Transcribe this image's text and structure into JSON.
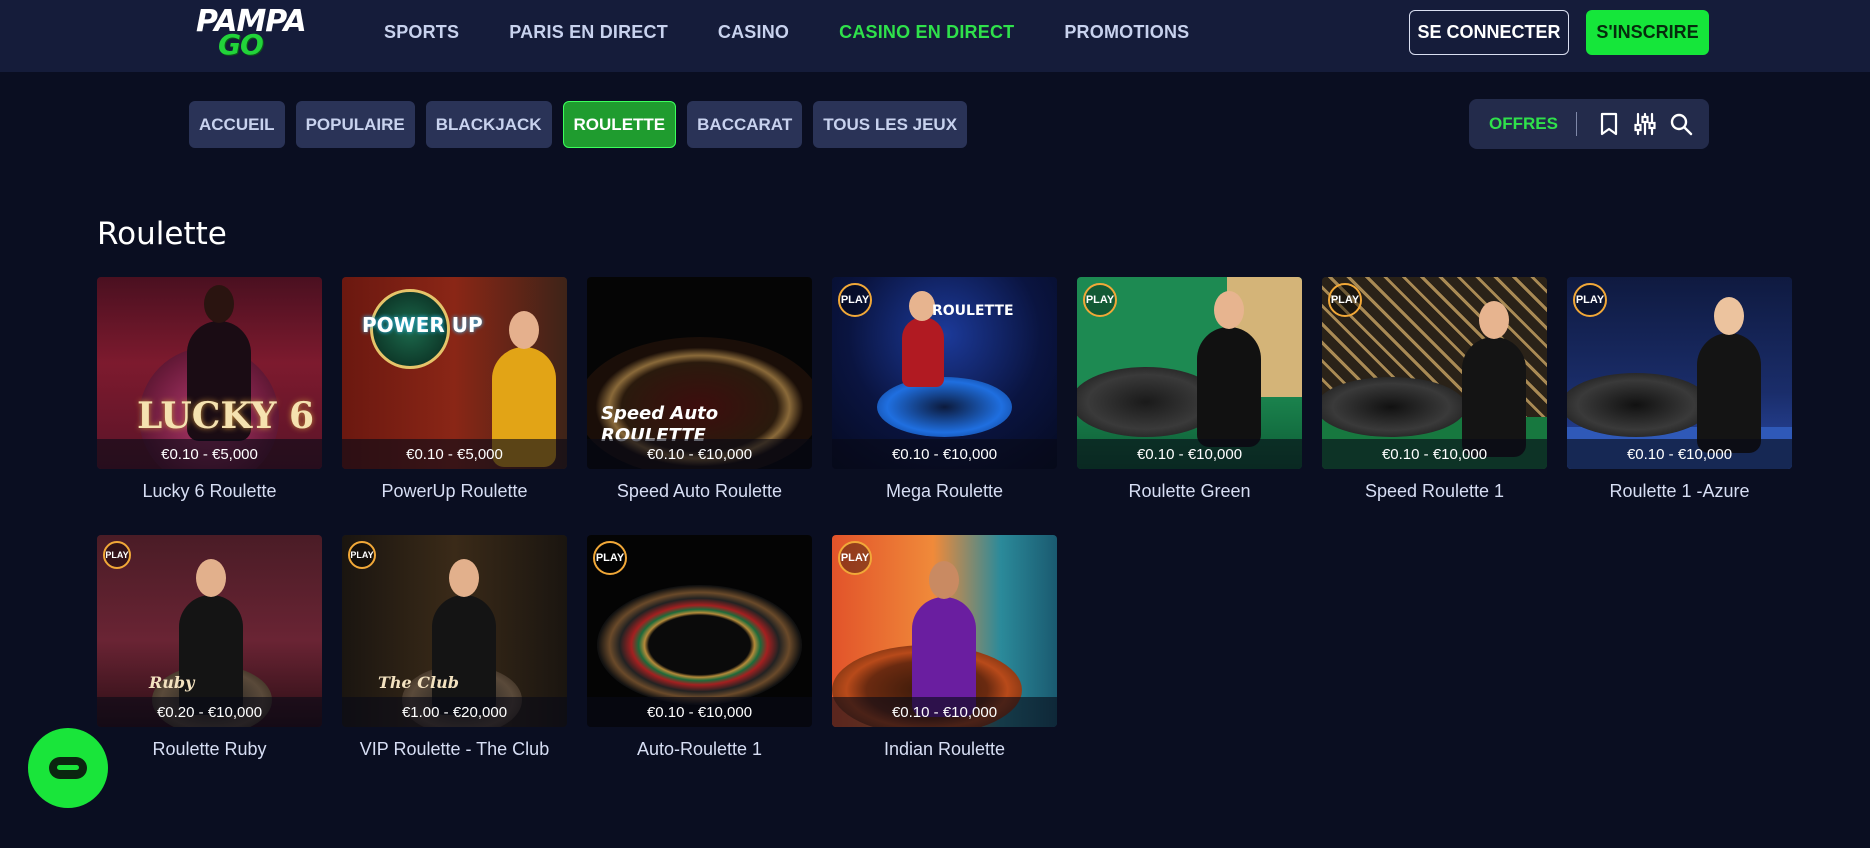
{
  "brand": {
    "line1": "PAMPA",
    "line2": "GO"
  },
  "nav": {
    "items": [
      {
        "label": "SPORTS",
        "active": false
      },
      {
        "label": "PARIS EN DIRECT",
        "active": false
      },
      {
        "label": "CASINO",
        "active": false
      },
      {
        "label": "CASINO EN DIRECT",
        "active": true
      },
      {
        "label": "PROMOTIONS",
        "active": false
      }
    ],
    "login_label": "SE CONNECTER",
    "signup_label": "S'INSCRIRE"
  },
  "categories": [
    {
      "label": "ACCUEIL",
      "active": false
    },
    {
      "label": "POPULAIRE",
      "active": false
    },
    {
      "label": "BLACKJACK",
      "active": false
    },
    {
      "label": "ROULETTE",
      "active": true
    },
    {
      "label": "BACCARAT",
      "active": false
    },
    {
      "label": "TOUS LES JEUX",
      "active": false
    }
  ],
  "tools": {
    "offers_label": "OFFRES",
    "icons": [
      "bookmark-icon",
      "filter-sliders-icon",
      "search-icon"
    ]
  },
  "section": {
    "title": "Roulette"
  },
  "games": [
    {
      "title": "Lucky 6 Roulette",
      "limits": "€0.10 - €5,000",
      "play_badge": false,
      "art_label": "LUCKY 6"
    },
    {
      "title": "PowerUp Roulette",
      "limits": "€0.10 - €5,000",
      "play_badge": false,
      "art_label": "POWER UP"
    },
    {
      "title": "Speed Auto Roulette",
      "limits": "€0.10 - €10,000",
      "play_badge": false,
      "art_label": "Speed Auto ROULETTE"
    },
    {
      "title": "Mega Roulette",
      "limits": "€0.10 - €10,000",
      "play_badge": true,
      "art_label": "ROULETTE"
    },
    {
      "title": "Roulette Green",
      "limits": "€0.10 - €10,000",
      "play_badge": true,
      "art_label": ""
    },
    {
      "title": "Speed Roulette 1",
      "limits": "€0.10 - €10,000",
      "play_badge": true,
      "art_label": ""
    },
    {
      "title": "Roulette 1 -Azure",
      "limits": "€0.10 - €10,000",
      "play_badge": true,
      "art_label": ""
    },
    {
      "title": "Roulette Ruby",
      "limits": "€0.20 - €10,000",
      "play_badge": true,
      "art_label": "Ruby"
    },
    {
      "title": "VIP Roulette - The Club",
      "limits": "€1.00 - €20,000",
      "play_badge": true,
      "art_label": "The Club"
    },
    {
      "title": "Auto-Roulette 1",
      "limits": "€0.10 - €10,000",
      "play_badge": true,
      "art_label": ""
    },
    {
      "title": "Indian Roulette",
      "limits": "€0.10 - €10,000",
      "play_badge": true,
      "art_label": ""
    }
  ],
  "badge_text": "PLAY",
  "colors": {
    "background": "#0a0e21",
    "header": "#151c3a",
    "accent_green": "#15e63a",
    "active_nav": "#2fe14b"
  }
}
